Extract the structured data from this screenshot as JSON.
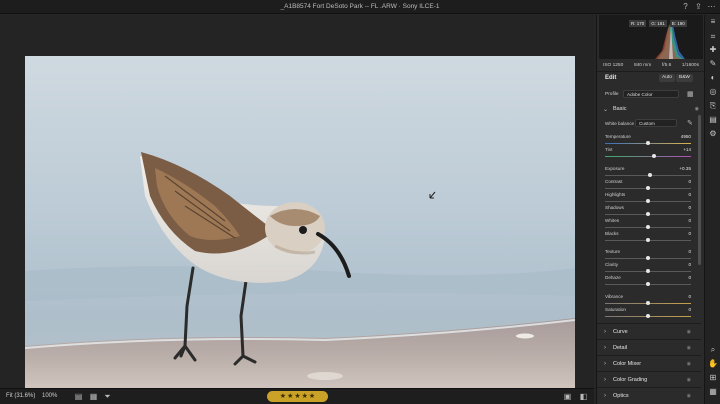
{
  "window": {
    "title": "_A1B8574 Fort DeSoto Park -- FL .ARW  ·  Sony ILCE-1"
  },
  "histogram": {
    "r": "R: 170",
    "g": "G: 181",
    "b": "B: 190"
  },
  "exif": {
    "iso": "ISO 1250",
    "focal": "840 mm",
    "aperture": "f/5.6",
    "shutter": "1/1600s"
  },
  "edit": {
    "title": "Edit",
    "auto_label": "Auto",
    "bw_label": "B&W"
  },
  "profile": {
    "label": "Profile",
    "value": "Adobe Color"
  },
  "basic": {
    "title": "Basic",
    "wb_label": "White balance",
    "wb_value": "Custom",
    "sliders": [
      {
        "label": "Temperature",
        "value": "4950",
        "pos": 0.5
      },
      {
        "label": "Tint",
        "value": "+14",
        "pos": 0.57
      },
      {
        "label": "Exposure",
        "value": "+0.35",
        "pos": 0.52
      },
      {
        "label": "Contrast",
        "value": "0",
        "pos": 0.5
      },
      {
        "label": "Highlights",
        "value": "0",
        "pos": 0.5
      },
      {
        "label": "Shadows",
        "value": "0",
        "pos": 0.5
      },
      {
        "label": "Whites",
        "value": "0",
        "pos": 0.5
      },
      {
        "label": "Blacks",
        "value": "0",
        "pos": 0.5
      },
      {
        "label": "Texture",
        "value": "0",
        "pos": 0.5
      },
      {
        "label": "Clarity",
        "value": "0",
        "pos": 0.5
      },
      {
        "label": "Dehaze",
        "value": "0",
        "pos": 0.5
      },
      {
        "label": "Vibrance",
        "value": "0",
        "pos": 0.5
      },
      {
        "label": "Saturation",
        "value": "0",
        "pos": 0.5
      }
    ]
  },
  "sections": [
    "Curve",
    "Detail",
    "Color Mixer",
    "Color Grading",
    "Optics"
  ],
  "bottom": {
    "fit": "Fit (31.6%)",
    "zoom": "100%"
  },
  "rating": {
    "stars": 5
  },
  "colors": {
    "accent": "#c9a227",
    "panel_bg": "#2b2b2b"
  }
}
